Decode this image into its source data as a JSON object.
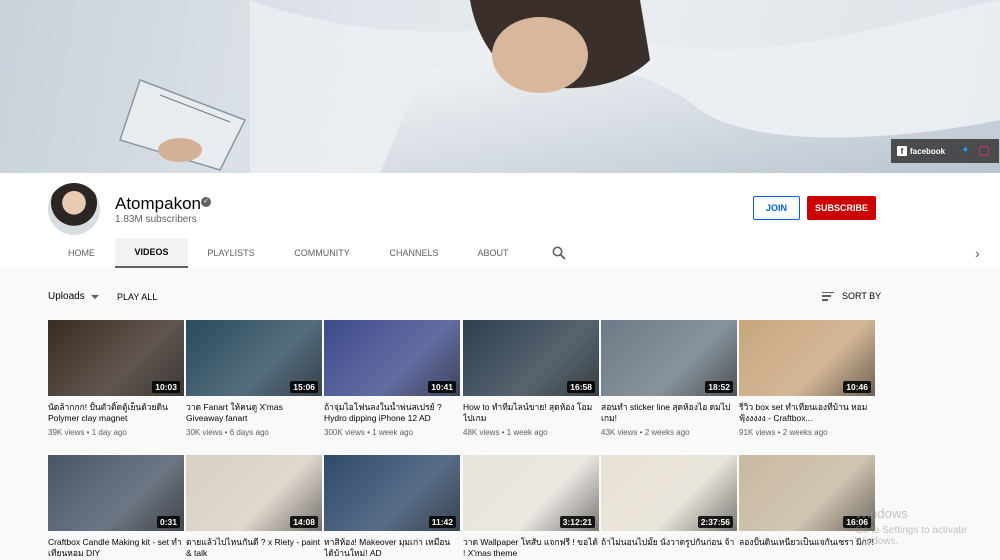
{
  "channel": {
    "name": "Atompakon",
    "subscribers": "1.83M subscribers",
    "join_label": "JOIN",
    "subscribe_label": "SUBSCRIBE"
  },
  "social": {
    "facebook": "facebook"
  },
  "tabs": [
    {
      "label": "HOME"
    },
    {
      "label": "VIDEOS"
    },
    {
      "label": "PLAYLISTS"
    },
    {
      "label": "COMMUNITY"
    },
    {
      "label": "CHANNELS"
    },
    {
      "label": "ABOUT"
    }
  ],
  "toolbar": {
    "uploads": "Uploads",
    "play_all": "PLAY ALL",
    "sort_by": "SORT BY"
  },
  "videos": [
    {
      "title": "นัดล้ากกก! ปั้นตัวติ๊ดตู้เย็นด้วยดิน Polymer clay magnet",
      "meta": "39K views • 1 day ago",
      "duration": "10:03"
    },
    {
      "title": "วาด Fanart ให้คนดู X'mas Giveaway fanart",
      "meta": "30K views • 6 days ago",
      "duration": "15:06"
    },
    {
      "title": "ถ้าจุ่มไอโฟนลงในน้ำพ่นสเปรย์ ? Hydro dipping iPhone 12 AD",
      "meta": "300K views • 1 week ago",
      "duration": "10:41"
    },
    {
      "title": "How to ทำทีมไลน์ขาย! สุดห้อง โอมไปเกม",
      "meta": "48K views • 1 week ago",
      "duration": "16:58"
    },
    {
      "title": "สอนทำ sticker line สุดห้องไอ ดมไปเกม!",
      "meta": "43K views • 2 weeks ago",
      "duration": "18:52"
    },
    {
      "title": "รีวิว box set ทำเทียนเองที่บ้าน หอมฟุ้งงงงง - Craftbox...",
      "meta": "91K views • 2 weeks ago",
      "duration": "10:46"
    },
    {
      "title": "Craftbox Candle Making kit - set ทำเทียนหอม DIY",
      "meta": "",
      "duration": "0:31"
    },
    {
      "title": "ตายแล้วไปไหนกันดี ? x Riety - paint & talk",
      "meta": "",
      "duration": "14:08"
    },
    {
      "title": "หาสิห้อง! Makeover มุมเก่า เหมือนได้บ้านใหม่! AD",
      "meta": "",
      "duration": "11:42"
    },
    {
      "title": "วาด Wallpaper โทสับ แจกฟรี ! ขอได้ ! X'mas theme",
      "meta": "",
      "duration": "3:12:21"
    },
    {
      "title": "ถ้าไม่นอนไปมั้ย นั่งวาดรูปกันก่อน จ้า",
      "meta": "",
      "duration": "2:37:56"
    },
    {
      "title": "ลองปั้นดินเหนียวเป็นแจกันเซรา มิก?!",
      "meta": "",
      "duration": "16:06"
    }
  ],
  "thumb_colors": [
    "#3a2c24",
    "#2a4a5e",
    "#3d4a8c",
    "#2e3f4d",
    "#6b7a86",
    "#c9a77e",
    "#4a5566",
    "#d9d0c4",
    "#2f4a6a",
    "#e8e4dc",
    "#e7e1d5",
    "#c8b9a0"
  ],
  "watermark": {
    "line1": "Windows",
    "line2": "Go to Settings to activate Windows."
  }
}
